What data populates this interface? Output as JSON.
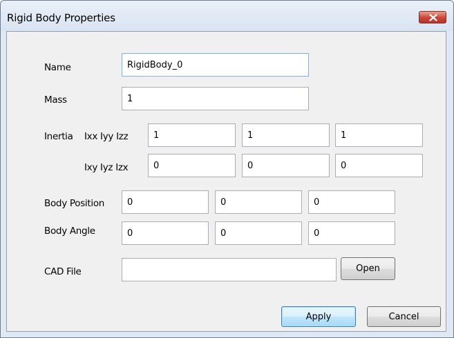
{
  "window": {
    "title": "Rigid Body Properties"
  },
  "labels": {
    "name": "Name",
    "mass": "Mass",
    "inertia": "Inertia",
    "inertia_diag": "Ixx Iyy Izz",
    "inertia_off": "Ixy Iyz Izx",
    "body_position": "Body Position",
    "body_angle": "Body Angle",
    "cad_file": "CAD File"
  },
  "fields": {
    "name": "RigidBody_0",
    "mass": "1",
    "ixx": "1",
    "iyy": "1",
    "izz": "1",
    "ixy": "0",
    "iyz": "0",
    "izx": "0",
    "pos_x": "0",
    "pos_y": "0",
    "pos_z": "0",
    "ang_x": "0",
    "ang_y": "0",
    "ang_z": "0",
    "cad_file": ""
  },
  "buttons": {
    "open": "Open",
    "apply": "Apply",
    "cancel": "Cancel"
  },
  "icons": {
    "close": "close-icon"
  }
}
